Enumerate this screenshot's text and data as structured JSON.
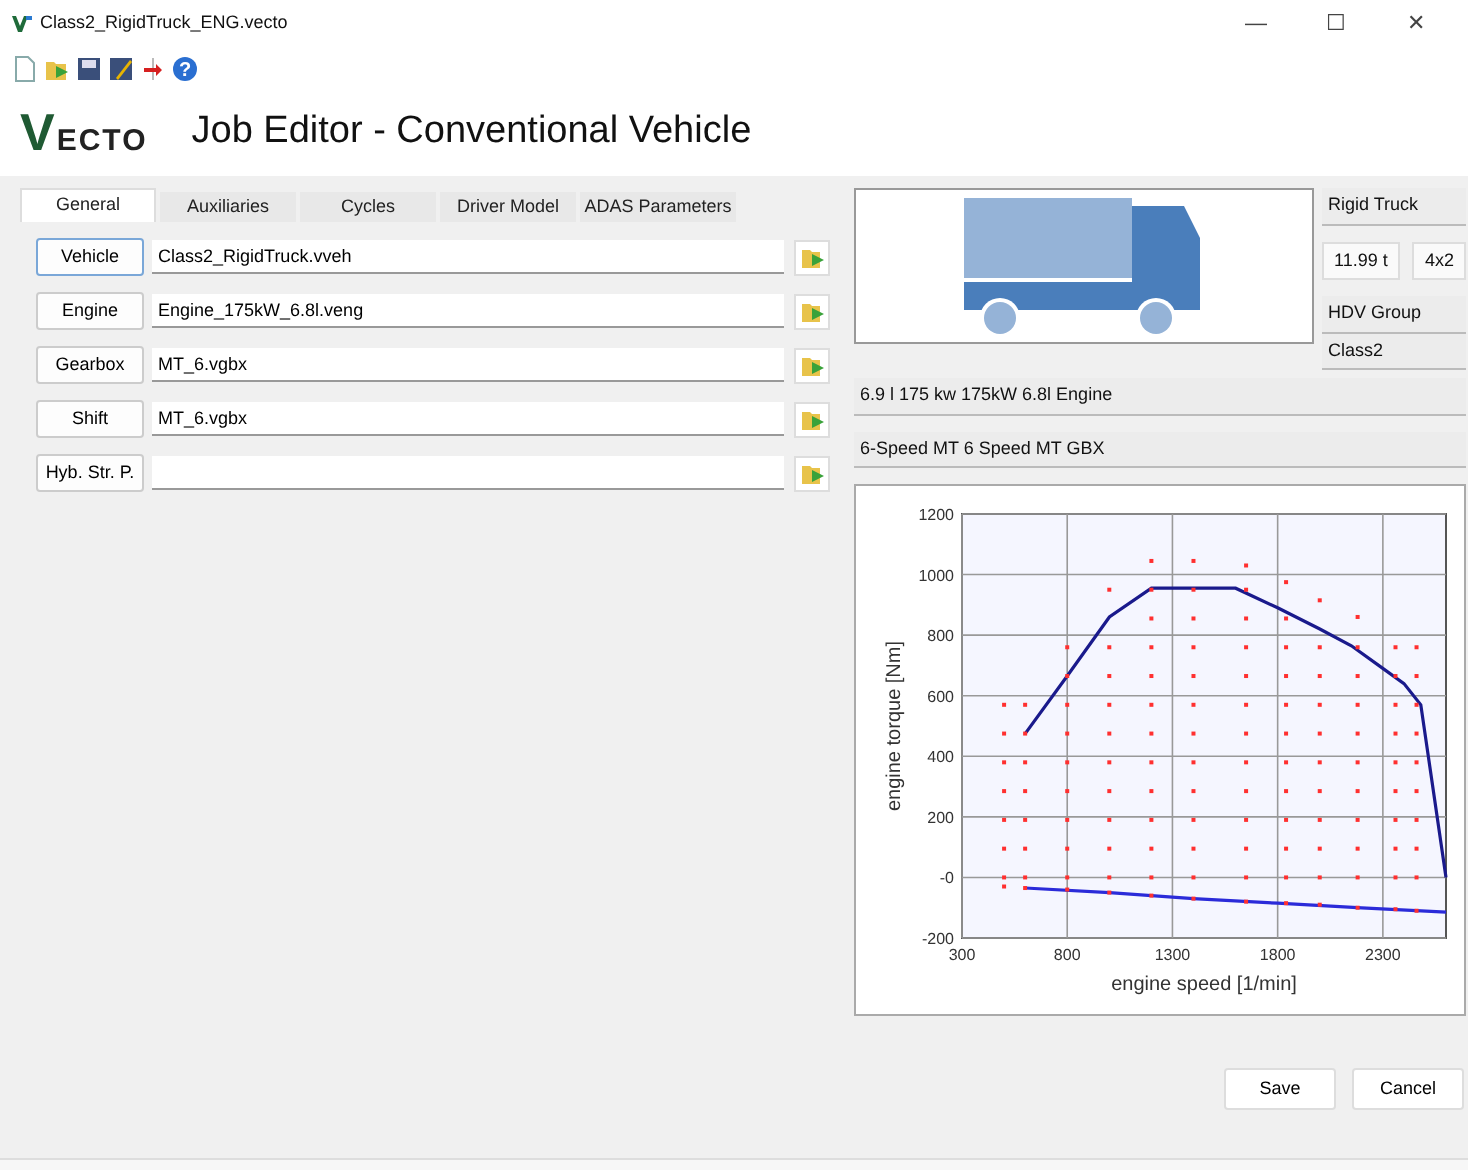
{
  "window": {
    "title": "Class2_RigidTruck_ENG.vecto",
    "controls": [
      "—",
      "☐",
      "✕"
    ]
  },
  "toolbar": [
    {
      "kind": "new"
    },
    {
      "kind": "open"
    },
    {
      "kind": "save"
    },
    {
      "kind": "save-as"
    },
    {
      "kind": "exit"
    },
    {
      "kind": "help",
      "glyph": "?"
    }
  ],
  "header": {
    "logo": "VECTO",
    "title": "Job Editor - Conventional Vehicle"
  },
  "tabs": [
    {
      "label": "General",
      "selected": true
    },
    {
      "label": "Auxiliaries",
      "selected": false
    },
    {
      "label": "Cycles",
      "selected": false
    },
    {
      "label": "Driver Model",
      "selected": false
    },
    {
      "label": "ADAS Parameters",
      "selected": false
    }
  ],
  "files": [
    {
      "button": "Vehicle",
      "value": "Class2_RigidTruck.vveh",
      "focused": true
    },
    {
      "button": "Engine",
      "value": "Engine_175kW_6.8l.veng",
      "focused": false
    },
    {
      "button": "Gearbox",
      "value": "MT_6.vgbx",
      "focused": false
    },
    {
      "button": "Shift",
      "value": "MT_6.vgbx",
      "focused": false
    },
    {
      "button": "Hyb. Str. P.",
      "focused": false
    }
  ],
  "vehicle": {
    "category": "Rigid Truck",
    "mass": "11.99 t",
    "axle": "4x2",
    "hdv_group_label": "HDV Group",
    "hdv_group": "Class2",
    "engine": "6.9 l 175 kw 175kW 6.8l Engine",
    "gearbox": "6-Speed MT 6 Speed MT GBX"
  },
  "chart": {
    "chart_data": {
      "type": "line",
      "xlabel": "engine speed [1/min]",
      "ylabel": "engine torque [Nm]",
      "xlim": [
        300,
        2600
      ],
      "ylim": [
        -200,
        1200
      ],
      "grid": true,
      "xticks": [
        300,
        800,
        1300,
        1800,
        2300
      ],
      "yticks": [
        {
          "value": -200,
          "label": "-200"
        },
        {
          "value": 0,
          "label": "-0"
        },
        {
          "value": 200,
          "label": "200"
        },
        {
          "value": 400,
          "label": "400"
        },
        {
          "value": 600,
          "label": "600"
        },
        {
          "value": 800,
          "label": "800"
        },
        {
          "value": 1000,
          "label": "1000"
        },
        {
          "value": 1200,
          "label": "1200"
        }
      ],
      "series": [
        {
          "color": "#1a1a8c",
          "x": [
            600,
            800,
            1000,
            1200,
            1600,
            1800,
            2000,
            2150,
            2300,
            2400,
            2480,
            2600
          ],
          "values": [
            475,
            665,
            860,
            955,
            955,
            890,
            820,
            765,
            690,
            640,
            570,
            0
          ]
        },
        {
          "color": "#2b2bd9",
          "x": [
            600,
            1000,
            1400,
            1800,
            2200,
            2600
          ],
          "values": [
            -35,
            -50,
            -70,
            -85,
            -100,
            -115
          ]
        },
        {
          "type": "scatter",
          "color": "#ff3030",
          "x": [
            500,
            500,
            500,
            500,
            500,
            500,
            500,
            500,
            600,
            600,
            600,
            600,
            600,
            600,
            600,
            600,
            800,
            800,
            800,
            800,
            800,
            800,
            800,
            800,
            800,
            800,
            1000,
            1000,
            1000,
            1000,
            1000,
            1000,
            1000,
            1000,
            1000,
            1000,
            1000,
            1200,
            1200,
            1200,
            1200,
            1200,
            1200,
            1200,
            1200,
            1200,
            1200,
            1200,
            1200,
            1200,
            1400,
            1400,
            1400,
            1400,
            1400,
            1400,
            1400,
            1400,
            1400,
            1400,
            1400,
            1400,
            1400,
            1650,
            1650,
            1650,
            1650,
            1650,
            1650,
            1650,
            1650,
            1650,
            1650,
            1650,
            1650,
            1650,
            1840,
            1840,
            1840,
            1840,
            1840,
            1840,
            1840,
            1840,
            1840,
            1840,
            1840,
            1840,
            2000,
            2000,
            2000,
            2000,
            2000,
            2000,
            2000,
            2000,
            2000,
            2000,
            2000,
            2180,
            2180,
            2180,
            2180,
            2180,
            2180,
            2180,
            2180,
            2180,
            2180,
            2180,
            2360,
            2360,
            2360,
            2360,
            2360,
            2360,
            2360,
            2360,
            2360,
            2360,
            2460,
            2460,
            2460,
            2460,
            2460,
            2460,
            2460,
            2460,
            2460,
            2460
          ],
          "values": [
            -30,
            0,
            95,
            190,
            285,
            380,
            475,
            570,
            -35,
            0,
            95,
            190,
            285,
            380,
            475,
            570,
            -40,
            0,
            95,
            190,
            285,
            380,
            475,
            570,
            665,
            760,
            -50,
            0,
            95,
            190,
            285,
            380,
            475,
            570,
            665,
            760,
            950,
            -60,
            0,
            95,
            190,
            285,
            380,
            475,
            570,
            665,
            760,
            855,
            950,
            1045,
            -70,
            0,
            95,
            190,
            285,
            380,
            475,
            570,
            665,
            760,
            855,
            950,
            1045,
            -80,
            0,
            95,
            190,
            285,
            380,
            475,
            570,
            665,
            760,
            855,
            950,
            1030,
            -85,
            0,
            95,
            190,
            285,
            380,
            475,
            570,
            665,
            760,
            855,
            975,
            -90,
            0,
            95,
            190,
            285,
            380,
            475,
            570,
            665,
            760,
            915,
            -100,
            0,
            95,
            190,
            285,
            380,
            475,
            570,
            665,
            760,
            860,
            -105,
            0,
            95,
            190,
            285,
            380,
            475,
            570,
            665,
            760,
            -110,
            0,
            95,
            190,
            285,
            380,
            475,
            570,
            665,
            760
          ]
        }
      ]
    }
  },
  "buttons": [
    "Save",
    "Cancel"
  ]
}
